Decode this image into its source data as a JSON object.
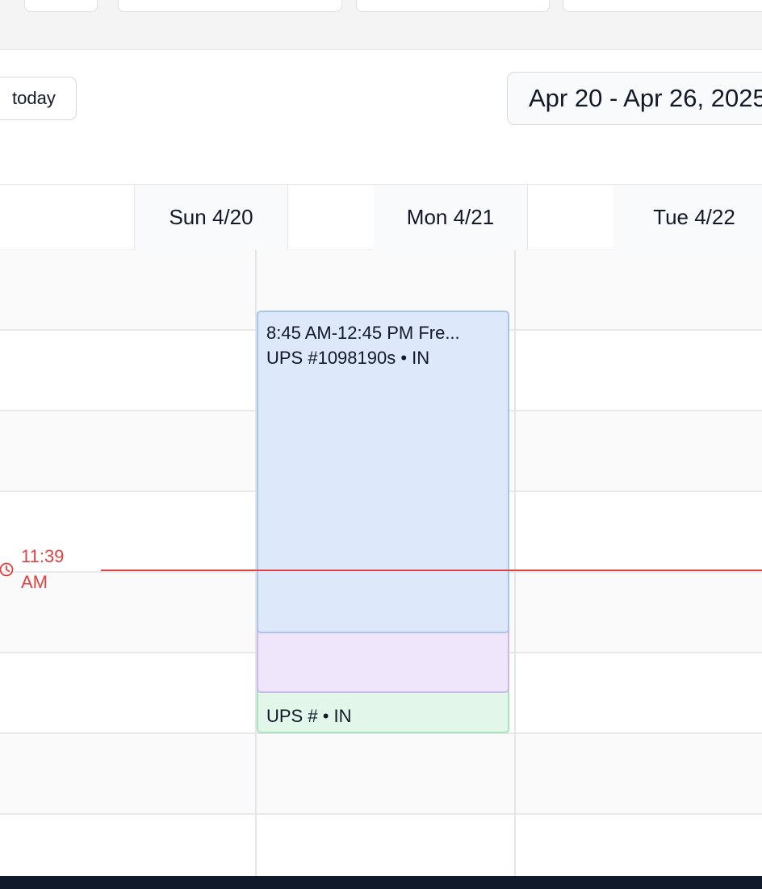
{
  "toolbar": {
    "today_label": "today",
    "date_range": "Apr 20 - Apr 26, 2025"
  },
  "days": [
    {
      "label": "Sun 4/20"
    },
    {
      "label": "Mon 4/21"
    },
    {
      "label": "Tue 4/22"
    }
  ],
  "events": {
    "blue": {
      "time_title": "8:45 AM-12:45 PM Fre...",
      "detail": "UPS #1098190s • IN",
      "color": "#dde8fa"
    },
    "purple": {
      "color": "#efe6fb"
    },
    "green": {
      "detail": "UPS # • IN",
      "color": "#e2f7e9"
    }
  },
  "now": {
    "time_label": "11:39\nAM",
    "color": "#dc4444"
  },
  "icons": {
    "now": "clock-icon"
  }
}
